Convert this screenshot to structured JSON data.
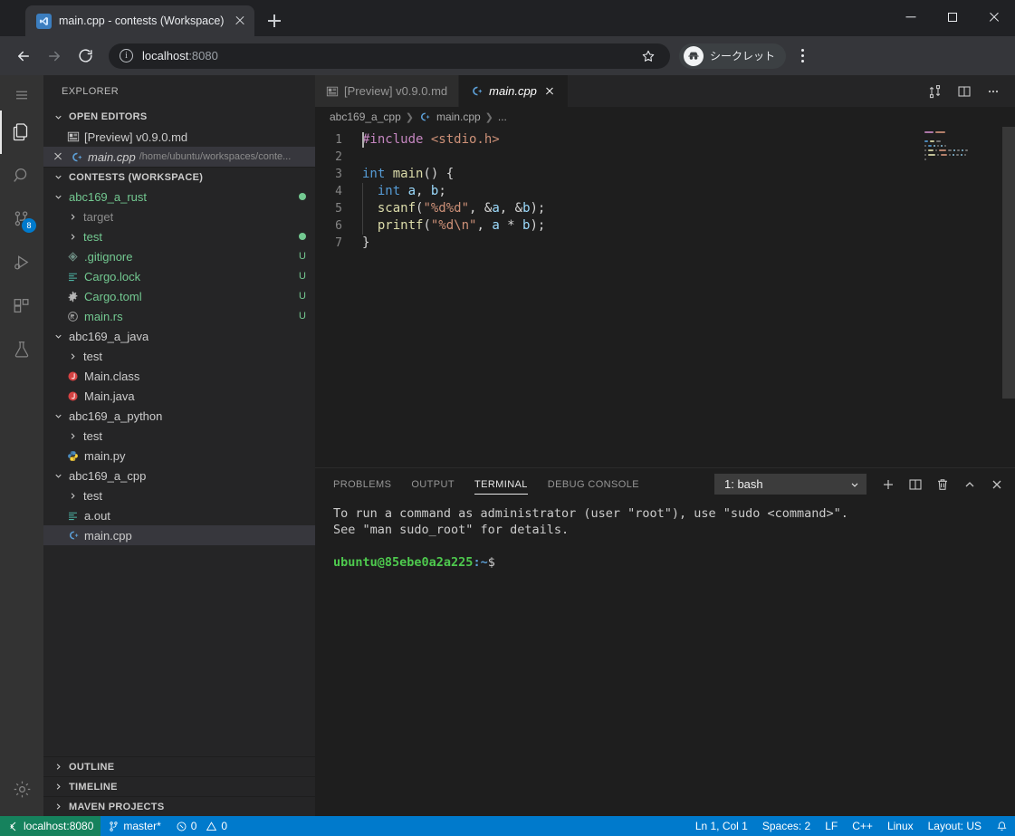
{
  "browser": {
    "tab": {
      "title": "main.cpp - contests (Workspace)",
      "favicon_icon": "vscode-icon",
      "close_icon": "close-icon"
    },
    "new_tab_icon": "plus-icon",
    "window_controls": {
      "minimize_icon": "minimize-icon",
      "maximize_icon": "maximize-icon",
      "close_icon": "close-icon"
    },
    "toolbar": {
      "back_icon": "arrow-left-icon",
      "forward_icon": "arrow-right-icon",
      "reload_icon": "reload-icon",
      "info_icon": "info-circle-icon",
      "url_host": "localhost",
      "url_port": ":8080",
      "star_icon": "star-icon",
      "incognito_label": "シークレット",
      "incognito_icon": "incognito-hat-icon",
      "menu_icon": "kebab-menu-icon"
    }
  },
  "activitybar": {
    "items": [
      {
        "name": "explorer",
        "icon": "files-icon",
        "badge": ""
      },
      {
        "name": "search",
        "icon": "search-icon",
        "badge": ""
      },
      {
        "name": "source-control",
        "icon": "source-control-icon",
        "badge": "8"
      },
      {
        "name": "run-debug",
        "icon": "run-debug-icon",
        "badge": ""
      },
      {
        "name": "extensions",
        "icon": "extensions-icon",
        "badge": ""
      },
      {
        "name": "testing",
        "icon": "beaker-icon",
        "badge": ""
      }
    ],
    "settings_icon": "gear-icon"
  },
  "sidebar": {
    "title": "EXPLORER",
    "sections": {
      "open_editors": {
        "label": "OPEN EDITORS",
        "items": [
          {
            "name": "[Preview] v0.9.0.md",
            "icon": "preview-icon",
            "desc": "",
            "selected": false
          },
          {
            "name": "main.cpp",
            "icon": "cpp-icon",
            "desc": "/home/ubuntu/workspaces/conte...",
            "selected": true
          }
        ]
      },
      "workspace": {
        "label": "CONTESTS (WORKSPACE)",
        "items": [
          {
            "indent": 1,
            "name": "abc169_a_rust",
            "kind": "folder",
            "expanded": true,
            "color": "green",
            "badge": "dot"
          },
          {
            "indent": 2,
            "name": "target",
            "kind": "folder",
            "expanded": false,
            "color": "gray",
            "badge": ""
          },
          {
            "indent": 2,
            "name": "test",
            "kind": "folder",
            "expanded": false,
            "color": "green",
            "badge": "dot"
          },
          {
            "indent": 2,
            "name": ".gitignore",
            "kind": "file",
            "icon": "gitignore-icon",
            "color": "green",
            "badge": "U"
          },
          {
            "indent": 2,
            "name": "Cargo.lock",
            "kind": "file",
            "icon": "lock-lines-icon",
            "color": "green",
            "badge": "U"
          },
          {
            "indent": 2,
            "name": "Cargo.toml",
            "kind": "file",
            "icon": "gear-config-icon",
            "color": "green",
            "badge": "U"
          },
          {
            "indent": 2,
            "name": "main.rs",
            "kind": "file",
            "icon": "rust-icon",
            "color": "green",
            "badge": "U"
          },
          {
            "indent": 1,
            "name": "abc169_a_java",
            "kind": "folder",
            "expanded": true,
            "color": "white",
            "badge": ""
          },
          {
            "indent": 2,
            "name": "test",
            "kind": "folder",
            "expanded": false,
            "color": "white",
            "badge": ""
          },
          {
            "indent": 2,
            "name": "Main.class",
            "kind": "file",
            "icon": "java-icon",
            "color": "white",
            "badge": ""
          },
          {
            "indent": 2,
            "name": "Main.java",
            "kind": "file",
            "icon": "java-icon",
            "color": "white",
            "badge": ""
          },
          {
            "indent": 1,
            "name": "abc169_a_python",
            "kind": "folder",
            "expanded": true,
            "color": "white",
            "badge": ""
          },
          {
            "indent": 2,
            "name": "test",
            "kind": "folder",
            "expanded": false,
            "color": "white",
            "badge": ""
          },
          {
            "indent": 2,
            "name": "main.py",
            "kind": "file",
            "icon": "python-icon",
            "color": "white",
            "badge": ""
          },
          {
            "indent": 1,
            "name": "abc169_a_cpp",
            "kind": "folder",
            "expanded": true,
            "color": "white",
            "badge": ""
          },
          {
            "indent": 2,
            "name": "test",
            "kind": "folder",
            "expanded": false,
            "color": "white",
            "badge": ""
          },
          {
            "indent": 2,
            "name": "a.out",
            "kind": "file",
            "icon": "binary-lines-icon",
            "color": "white",
            "badge": ""
          },
          {
            "indent": 2,
            "name": "main.cpp",
            "kind": "file",
            "icon": "cpp-icon",
            "color": "white",
            "badge": "",
            "selected": true
          }
        ]
      },
      "collapsed": [
        {
          "label": "OUTLINE"
        },
        {
          "label": "TIMELINE"
        },
        {
          "label": "MAVEN PROJECTS"
        }
      ]
    }
  },
  "editor": {
    "tabs": [
      {
        "label": "[Preview] v0.9.0.md",
        "icon": "preview-icon",
        "active": false,
        "closable": false
      },
      {
        "label": "main.cpp",
        "icon": "cpp-icon",
        "active": true,
        "closable": true
      }
    ],
    "actions": [
      {
        "name": "run-compare-icon"
      },
      {
        "name": "split-editor-icon"
      },
      {
        "name": "more-actions-icon"
      }
    ],
    "breadcrumbs": [
      "abc169_a_cpp",
      "main.cpp",
      "..."
    ],
    "lines": [
      {
        "n": "1",
        "tokens": [
          {
            "t": "#include ",
            "c": "kw"
          },
          {
            "t": "<stdio.h>",
            "c": "inc-path"
          }
        ]
      },
      {
        "n": "2",
        "tokens": []
      },
      {
        "n": "3",
        "tokens": [
          {
            "t": "int ",
            "c": "typ"
          },
          {
            "t": "main",
            "c": "fn"
          },
          {
            "t": "() {",
            "c": "pun"
          }
        ]
      },
      {
        "n": "4",
        "tokens": [
          {
            "t": "  ",
            "c": "pun"
          },
          {
            "t": "int ",
            "c": "typ"
          },
          {
            "t": "a",
            "c": "var"
          },
          {
            "t": ", ",
            "c": "pun"
          },
          {
            "t": "b",
            "c": "var"
          },
          {
            "t": ";",
            "c": "pun"
          }
        ]
      },
      {
        "n": "5",
        "tokens": [
          {
            "t": "  ",
            "c": "pun"
          },
          {
            "t": "scanf",
            "c": "fn"
          },
          {
            "t": "(",
            "c": "pun"
          },
          {
            "t": "\"%d%d\"",
            "c": "str"
          },
          {
            "t": ", &",
            "c": "pun"
          },
          {
            "t": "a",
            "c": "var"
          },
          {
            "t": ", &",
            "c": "pun"
          },
          {
            "t": "b",
            "c": "var"
          },
          {
            "t": ");",
            "c": "pun"
          }
        ]
      },
      {
        "n": "6",
        "tokens": [
          {
            "t": "  ",
            "c": "pun"
          },
          {
            "t": "printf",
            "c": "fn"
          },
          {
            "t": "(",
            "c": "pun"
          },
          {
            "t": "\"%d\\n\"",
            "c": "str"
          },
          {
            "t": ", ",
            "c": "pun"
          },
          {
            "t": "a",
            "c": "var"
          },
          {
            "t": " * ",
            "c": "pun"
          },
          {
            "t": "b",
            "c": "var"
          },
          {
            "t": ");",
            "c": "pun"
          }
        ]
      },
      {
        "n": "7",
        "tokens": [
          {
            "t": "}",
            "c": "pun"
          }
        ]
      }
    ]
  },
  "panel": {
    "tabs": [
      {
        "label": "PROBLEMS",
        "active": false
      },
      {
        "label": "OUTPUT",
        "active": false
      },
      {
        "label": "TERMINAL",
        "active": true
      },
      {
        "label": "DEBUG CONSOLE",
        "active": false
      }
    ],
    "terminal_select": "1: bash",
    "terminal_select_icon": "chevron-down-icon",
    "actions": [
      {
        "name": "new-terminal-icon"
      },
      {
        "name": "split-terminal-icon"
      },
      {
        "name": "kill-terminal-icon"
      },
      {
        "name": "maximize-panel-icon"
      },
      {
        "name": "close-panel-icon"
      }
    ],
    "terminal_lines": [
      {
        "type": "plain",
        "text": "To run a command as administrator (user \"root\"), use \"sudo <command>\"."
      },
      {
        "type": "plain",
        "text": "See \"man sudo_root\" for details."
      },
      {
        "type": "blank",
        "text": ""
      },
      {
        "type": "prompt",
        "user": "ubuntu@85ebe0a2a225",
        "path": ":~",
        "sym": "$"
      }
    ]
  },
  "statusbar": {
    "remote": {
      "label": "localhost:8080",
      "icon": "remote-icon"
    },
    "left": [
      {
        "label": "master*",
        "icon": "git-branch-icon"
      },
      {
        "label": "0",
        "icon": "error-icon",
        "second_label": "0",
        "second_icon": "warning-icon"
      }
    ],
    "right": [
      {
        "label": "Ln 1, Col 1"
      },
      {
        "label": "Spaces: 2"
      },
      {
        "label": "LF"
      },
      {
        "label": "C++"
      },
      {
        "label": "Linux"
      },
      {
        "label": "Layout: US"
      },
      {
        "label": "",
        "icon": "bell-icon"
      }
    ]
  },
  "colors": {
    "accent_blue": "#007acc",
    "remote_green": "#16825d",
    "git_untracked": "#73c991",
    "badge_blue": "#007acc"
  }
}
